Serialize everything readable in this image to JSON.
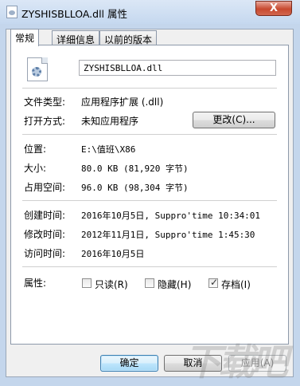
{
  "window": {
    "title": "ZYSHISBLLOA.dll 属性",
    "close_glyph": "X"
  },
  "tabs": [
    {
      "label": "常规",
      "active": true
    },
    {
      "label": "详细信息",
      "active": false
    },
    {
      "label": "以前的版本",
      "active": false
    }
  ],
  "general": {
    "file_name": "ZYSHISBLLOA.dll",
    "file_type_label": "文件类型:",
    "file_type_value": "应用程序扩展 (.dll)",
    "open_with_label": "打开方式:",
    "open_with_value": "未知应用程序",
    "change_button": "更改(C)...",
    "location_label": "位置:",
    "location_value": "E:\\值班\\X86",
    "size_label": "大小:",
    "size_value": "80.0 KB (81,920 字节)",
    "size_on_disk_label": "占用空间:",
    "size_on_disk_value": "96.0 KB (98,304 字节)",
    "created_label": "创建时间:",
    "created_value": "2016年10月5日, Suppro'time 10:34:01",
    "modified_label": "修改时间:",
    "modified_value": "2012年11月1日, Suppro'time 1:45:30",
    "accessed_label": "访问时间:",
    "accessed_value": "2016年10月5日",
    "attributes_label": "属性:",
    "attributes": [
      {
        "label": "只读(R)",
        "checked": false
      },
      {
        "label": "隐藏(H)",
        "checked": false
      },
      {
        "label": "存档(I)",
        "checked": true
      }
    ]
  },
  "footer": {
    "ok": "确定",
    "cancel": "取消",
    "apply": "应用(A)"
  },
  "watermark": "下载吧",
  "colors": {
    "accent": "#3c7fb1",
    "close": "#c7492f"
  }
}
